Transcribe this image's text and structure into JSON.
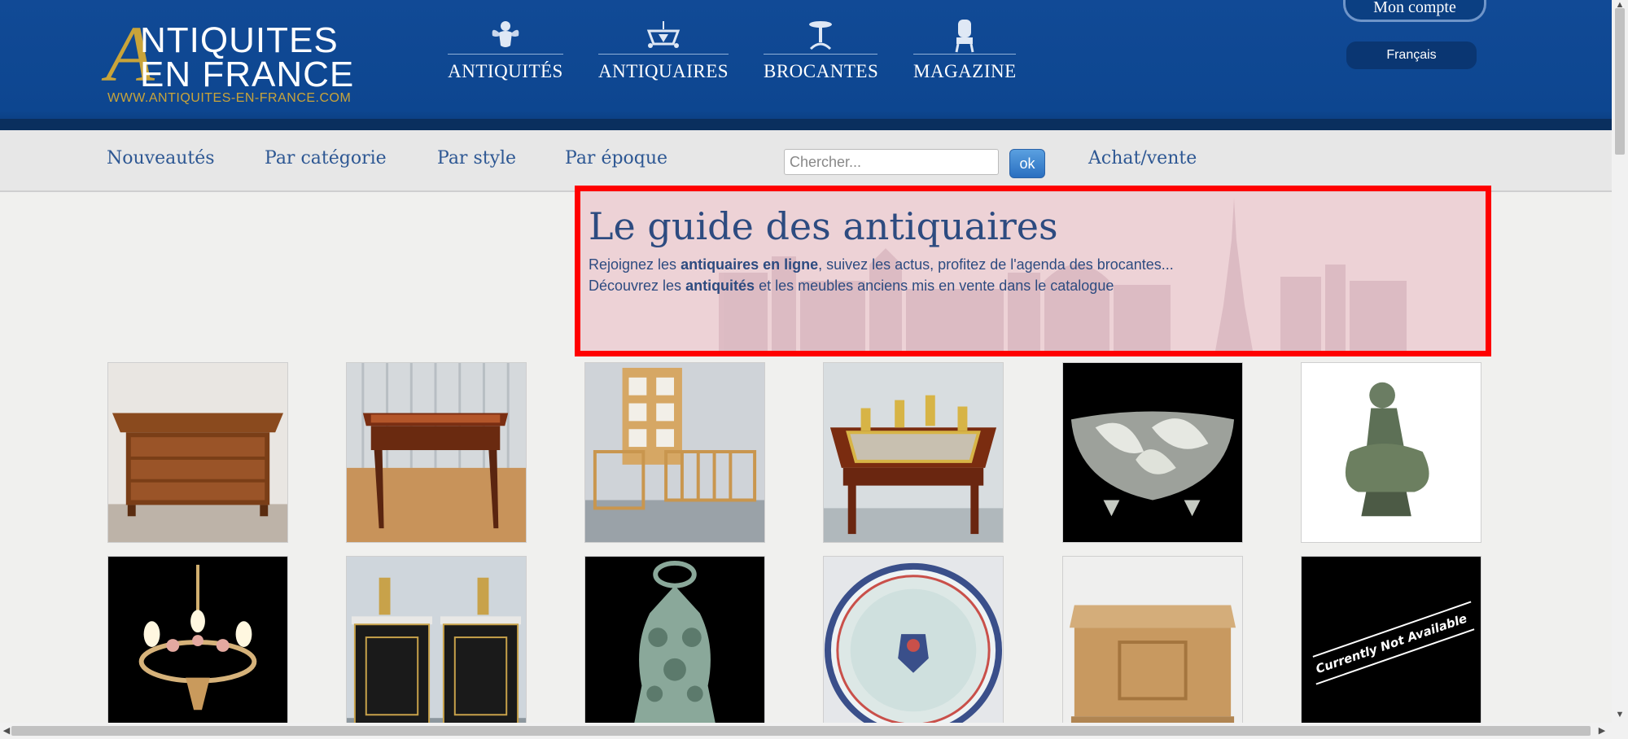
{
  "header": {
    "logo": {
      "big_letter": "A",
      "line1": "NTIQUITES",
      "line2": "EN FRANCE",
      "url": "WWW.ANTIQUITES-EN-FRANCE.COM"
    },
    "main_nav": [
      {
        "label": "ANTIQUITÉS",
        "icon": "cherub-icon"
      },
      {
        "label": "ANTIQUAIRES",
        "icon": "chandelier-icon"
      },
      {
        "label": "BROCANTES",
        "icon": "pedestal-table-icon"
      },
      {
        "label": "MAGAZINE",
        "icon": "armchair-icon"
      }
    ],
    "account_label": "Mon compte",
    "language": "Français"
  },
  "subnav": {
    "links": [
      "Nouveautés",
      "Par catégorie",
      "Par style",
      "Par époque"
    ],
    "search_placeholder": "Chercher...",
    "search_button": "ok",
    "buy_sell": "Achat/vente"
  },
  "guide": {
    "title": "Le guide des antiquaires",
    "line1_pre": "Rejoignez les ",
    "line1_bold": "antiquaires en ligne",
    "line1_post": ", suivez les actus, profitez de l'agenda des brocantes...",
    "line2_pre": "Découvrez les ",
    "line2_bold": "antiquités",
    "line2_post": " et les meubles anciens mis en vente dans le catalogue"
  },
  "products": [
    {
      "subject": "commode"
    },
    {
      "subject": "writing-desk"
    },
    {
      "subject": "bamboo-furniture"
    },
    {
      "subject": "gilt-table"
    },
    {
      "subject": "glass-bowl"
    },
    {
      "subject": "bronze-figurine"
    },
    {
      "subject": "chandelier"
    },
    {
      "subject": "pair-of-cabinets"
    },
    {
      "subject": "cast-iron-ornament"
    },
    {
      "subject": "porcelain-platter"
    },
    {
      "subject": "oak-chest"
    },
    {
      "subject": "unavailable",
      "overlay_text": "Currently Not Available"
    }
  ],
  "colors": {
    "header_blue": "#114a96",
    "gold": "#c9a43a",
    "link_blue": "#2d5793",
    "highlight_red": "#ff0000"
  }
}
